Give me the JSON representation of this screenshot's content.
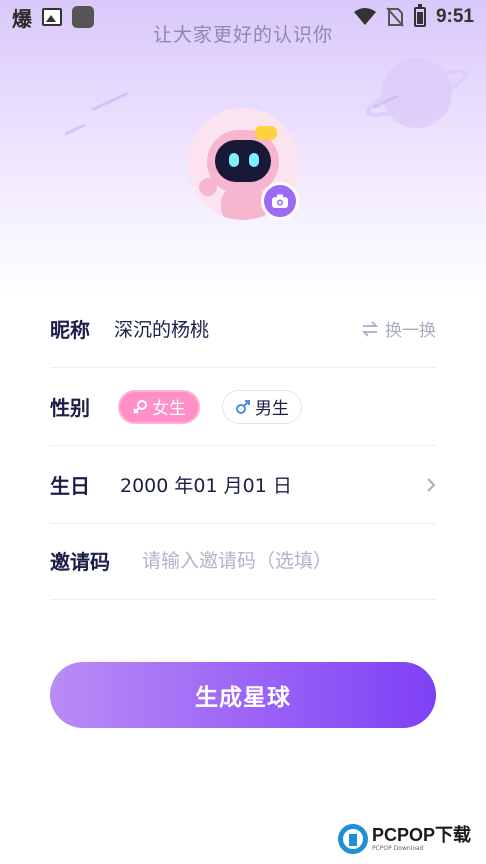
{
  "status_bar": {
    "left_glyph": "爆",
    "time": "9:51",
    "icons": [
      "image-icon",
      "app-square-icon",
      "wifi-icon",
      "no-sim-icon",
      "battery-charging-icon"
    ]
  },
  "header": {
    "title": "让大家更好的认识你"
  },
  "avatar": {
    "camera_icon": "camera-icon"
  },
  "form": {
    "nickname": {
      "label": "昵称",
      "value": "深沉的杨桃",
      "swap_label": "换一换",
      "swap_icon": "swap-arrows-icon"
    },
    "gender": {
      "label": "性别",
      "female_label": "女生",
      "male_label": "男生",
      "selected": "female"
    },
    "birthday": {
      "label": "生日",
      "value": "2000 年01 月01 日"
    },
    "invite": {
      "label": "邀请码",
      "placeholder": "请输入邀请码（选填）",
      "value": ""
    }
  },
  "submit": {
    "label": "生成星球"
  },
  "watermark": {
    "main": "PCPOP下载",
    "sub": "PCPOP Download"
  },
  "colors": {
    "accent_purple": "#9a62f7",
    "female_pink": "#ff8fc6",
    "text_dark": "#1c1f4a",
    "placeholder_gray": "#b0b4c8"
  }
}
